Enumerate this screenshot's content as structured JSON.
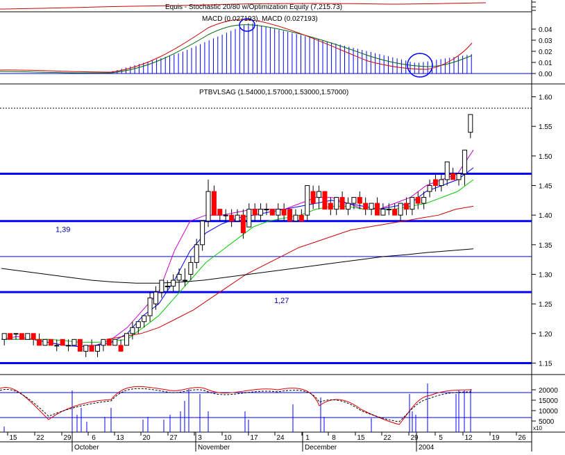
{
  "colors": {
    "axis": "#000000",
    "up_candle": "#ffffff",
    "down_candle": "#ff0000",
    "ma_blue": "#0000ff",
    "ma_green": "#00cc00",
    "ma_red": "#cc0000",
    "ma_black": "#000000",
    "ma_magenta": "#cc00cc",
    "hline": "#0000ff",
    "macd_hist": "#0000ff",
    "macd_signal": "#006600",
    "macd_line": "#cc0000",
    "stoch_k": "#dd0000",
    "stoch_d": "#000000",
    "volume": "#0000ff"
  },
  "panels": {
    "equity": {
      "title": "Equis - Stochastic 20/80  w/Optimization Equity (7,215.73)"
    },
    "macd": {
      "title": "MACD (0.027193), MACD (0.027193)",
      "y_ticks": [
        "0.04",
        "0.03",
        "0.02",
        "0.01",
        "0.00"
      ]
    },
    "price": {
      "title": "PTBVLSAG (1.54000,1.57000,1.53000,1.57000)",
      "y_ticks": [
        "1.60",
        "1.55",
        "1.50",
        "1.45",
        "1.40",
        "1.35",
        "1.30",
        "1.25",
        "1.20",
        "1.15"
      ],
      "annotations": [
        "1,39",
        "1,27"
      ]
    },
    "lower": {
      "y_ticks": [
        "20000",
        "15000",
        "10000",
        "5000"
      ],
      "scale_label": "x10"
    }
  },
  "x_axis": {
    "day_ticks": [
      "15",
      "22",
      "29",
      "6",
      "13",
      "20",
      "27",
      "3",
      "10",
      "17",
      "24",
      "1",
      "8",
      "15",
      "22",
      "29",
      "5",
      "12",
      "19",
      "26"
    ],
    "month_labels": [
      "October",
      "November",
      "December",
      "2004"
    ]
  },
  "chart_data": {
    "type": "candlestick",
    "title": "PTBVLSAG (1.54000,1.57000,1.53000,1.57000)",
    "ylim": [
      1.14,
      1.61
    ],
    "last_bar": {
      "open": 1.54,
      "high": 1.57,
      "low": 1.53,
      "close": 1.57
    },
    "horizontal_levels": [
      1.47,
      1.39,
      1.33,
      1.27,
      1.15
    ],
    "level_labels": [
      {
        "text": "1,39",
        "y": 1.39
      },
      {
        "text": "1,27",
        "y": 1.27
      }
    ],
    "candles": [
      [
        1.19,
        1.2,
        1.18,
        1.2
      ],
      [
        1.2,
        1.2,
        1.19,
        1.19
      ],
      [
        1.2,
        1.2,
        1.19,
        1.2
      ],
      [
        1.2,
        1.2,
        1.19,
        1.19
      ],
      [
        1.19,
        1.2,
        1.19,
        1.2
      ],
      [
        1.2,
        1.2,
        1.18,
        1.19
      ],
      [
        1.19,
        1.2,
        1.18,
        1.18
      ],
      [
        1.18,
        1.19,
        1.18,
        1.19
      ],
      [
        1.19,
        1.19,
        1.18,
        1.18
      ],
      [
        1.18,
        1.19,
        1.17,
        1.18
      ],
      [
        1.19,
        1.19,
        1.18,
        1.18
      ],
      [
        1.18,
        1.19,
        1.17,
        1.18
      ],
      [
        1.18,
        1.19,
        1.18,
        1.19
      ],
      [
        1.19,
        1.19,
        1.17,
        1.17
      ],
      [
        1.17,
        1.18,
        1.16,
        1.18
      ],
      [
        1.18,
        1.19,
        1.17,
        1.17
      ],
      [
        1.17,
        1.18,
        1.16,
        1.18
      ],
      [
        1.18,
        1.19,
        1.17,
        1.19
      ],
      [
        1.19,
        1.19,
        1.18,
        1.18
      ],
      [
        1.18,
        1.19,
        1.18,
        1.19
      ],
      [
        1.18,
        1.19,
        1.17,
        1.17
      ],
      [
        1.18,
        1.2,
        1.18,
        1.2
      ],
      [
        1.2,
        1.22,
        1.19,
        1.21
      ],
      [
        1.21,
        1.22,
        1.2,
        1.22
      ],
      [
        1.22,
        1.23,
        1.21,
        1.23
      ],
      [
        1.23,
        1.27,
        1.22,
        1.26
      ],
      [
        1.25,
        1.28,
        1.24,
        1.27
      ],
      [
        1.27,
        1.29,
        1.26,
        1.29
      ],
      [
        1.28,
        1.29,
        1.27,
        1.28
      ],
      [
        1.28,
        1.3,
        1.27,
        1.29
      ],
      [
        1.29,
        1.31,
        1.27,
        1.3
      ],
      [
        1.29,
        1.31,
        1.28,
        1.29
      ],
      [
        1.3,
        1.33,
        1.29,
        1.32
      ],
      [
        1.32,
        1.36,
        1.31,
        1.35
      ],
      [
        1.35,
        1.39,
        1.34,
        1.39
      ],
      [
        1.39,
        1.46,
        1.38,
        1.44
      ],
      [
        1.44,
        1.45,
        1.4,
        1.4
      ],
      [
        1.41,
        1.41,
        1.39,
        1.4
      ],
      [
        1.4,
        1.41,
        1.39,
        1.4
      ],
      [
        1.4,
        1.41,
        1.38,
        1.39
      ],
      [
        1.39,
        1.41,
        1.39,
        1.4
      ],
      [
        1.4,
        1.41,
        1.36,
        1.37
      ],
      [
        1.38,
        1.42,
        1.38,
        1.41
      ],
      [
        1.41,
        1.42,
        1.39,
        1.4
      ],
      [
        1.4,
        1.42,
        1.39,
        1.41
      ],
      [
        1.41,
        1.42,
        1.4,
        1.41
      ],
      [
        1.41,
        1.41,
        1.4,
        1.4
      ],
      [
        1.4,
        1.42,
        1.39,
        1.41
      ],
      [
        1.41,
        1.42,
        1.39,
        1.4
      ],
      [
        1.41,
        1.41,
        1.39,
        1.39
      ],
      [
        1.39,
        1.41,
        1.39,
        1.4
      ],
      [
        1.4,
        1.41,
        1.39,
        1.39
      ],
      [
        1.4,
        1.45,
        1.39,
        1.45
      ],
      [
        1.44,
        1.45,
        1.41,
        1.42
      ],
      [
        1.43,
        1.45,
        1.41,
        1.44
      ],
      [
        1.44,
        1.44,
        1.41,
        1.41
      ],
      [
        1.42,
        1.43,
        1.4,
        1.41
      ],
      [
        1.41,
        1.43,
        1.4,
        1.43
      ],
      [
        1.43,
        1.44,
        1.41,
        1.41
      ],
      [
        1.41,
        1.43,
        1.4,
        1.42
      ],
      [
        1.42,
        1.43,
        1.41,
        1.43
      ],
      [
        1.43,
        1.44,
        1.41,
        1.42
      ],
      [
        1.42,
        1.43,
        1.4,
        1.41
      ],
      [
        1.41,
        1.42,
        1.4,
        1.42
      ],
      [
        1.42,
        1.43,
        1.4,
        1.4
      ],
      [
        1.4,
        1.42,
        1.4,
        1.41
      ],
      [
        1.41,
        1.42,
        1.4,
        1.41
      ],
      [
        1.41,
        1.42,
        1.4,
        1.4
      ],
      [
        1.4,
        1.42,
        1.39,
        1.42
      ],
      [
        1.42,
        1.43,
        1.4,
        1.41
      ],
      [
        1.41,
        1.43,
        1.4,
        1.43
      ],
      [
        1.43,
        1.44,
        1.41,
        1.42
      ],
      [
        1.42,
        1.44,
        1.41,
        1.43
      ],
      [
        1.44,
        1.46,
        1.43,
        1.45
      ],
      [
        1.46,
        1.47,
        1.44,
        1.45
      ],
      [
        1.45,
        1.47,
        1.44,
        1.46
      ],
      [
        1.46,
        1.49,
        1.45,
        1.49
      ],
      [
        1.47,
        1.48,
        1.46,
        1.46
      ],
      [
        1.46,
        1.47,
        1.45,
        1.47
      ],
      [
        1.47,
        1.51,
        1.45,
        1.51
      ],
      [
        1.54,
        1.57,
        1.53,
        1.57
      ]
    ],
    "moving_averages": [
      {
        "color_key": "ma_magenta",
        "start": 0,
        "values": [
          1.19,
          1.195,
          1.19,
          1.185,
          1.18,
          1.178,
          1.18,
          1.19,
          1.21,
          1.24,
          1.27,
          1.34,
          1.39,
          1.4,
          1.4,
          1.405,
          1.41,
          1.41,
          1.41,
          1.42,
          1.43,
          1.43,
          1.42,
          1.41,
          1.41,
          1.42,
          1.43,
          1.45,
          1.46,
          1.47,
          1.51
        ]
      },
      {
        "color_key": "ma_blue",
        "start": 0,
        "values": [
          1.19,
          1.19,
          1.19,
          1.185,
          1.18,
          1.178,
          1.18,
          1.185,
          1.2,
          1.23,
          1.25,
          1.29,
          1.34,
          1.37,
          1.385,
          1.395,
          1.4,
          1.405,
          1.41,
          1.415,
          1.42,
          1.425,
          1.42,
          1.415,
          1.41,
          1.415,
          1.42,
          1.44,
          1.45,
          1.46,
          1.48
        ]
      },
      {
        "color_key": "ma_green",
        "start": 0,
        "values": [
          1.19,
          1.19,
          1.19,
          1.19,
          1.188,
          1.185,
          1.185,
          1.187,
          1.19,
          1.21,
          1.23,
          1.26,
          1.29,
          1.32,
          1.34,
          1.36,
          1.38,
          1.39,
          1.395,
          1.4,
          1.41,
          1.415,
          1.415,
          1.41,
          1.41,
          1.41,
          1.415,
          1.42,
          1.43,
          1.44,
          1.46
        ]
      },
      {
        "color_key": "ma_red",
        "start": 18,
        "values": [
          1.19,
          1.195,
          1.2,
          1.21,
          1.225,
          1.24,
          1.26,
          1.28,
          1.3,
          1.315,
          1.33,
          1.345,
          1.355,
          1.365,
          1.375,
          1.38,
          1.385,
          1.39,
          1.395,
          1.4,
          1.41,
          1.415
        ]
      },
      {
        "color_key": "ma_black",
        "start": 0,
        "values": [
          1.31,
          1.305,
          1.3,
          1.295,
          1.29,
          1.287,
          1.285,
          1.285,
          1.287,
          1.29,
          1.295,
          1.3,
          1.305,
          1.31,
          1.315,
          1.32,
          1.325,
          1.33,
          1.333,
          1.337,
          1.34,
          1.343
        ]
      }
    ]
  }
}
